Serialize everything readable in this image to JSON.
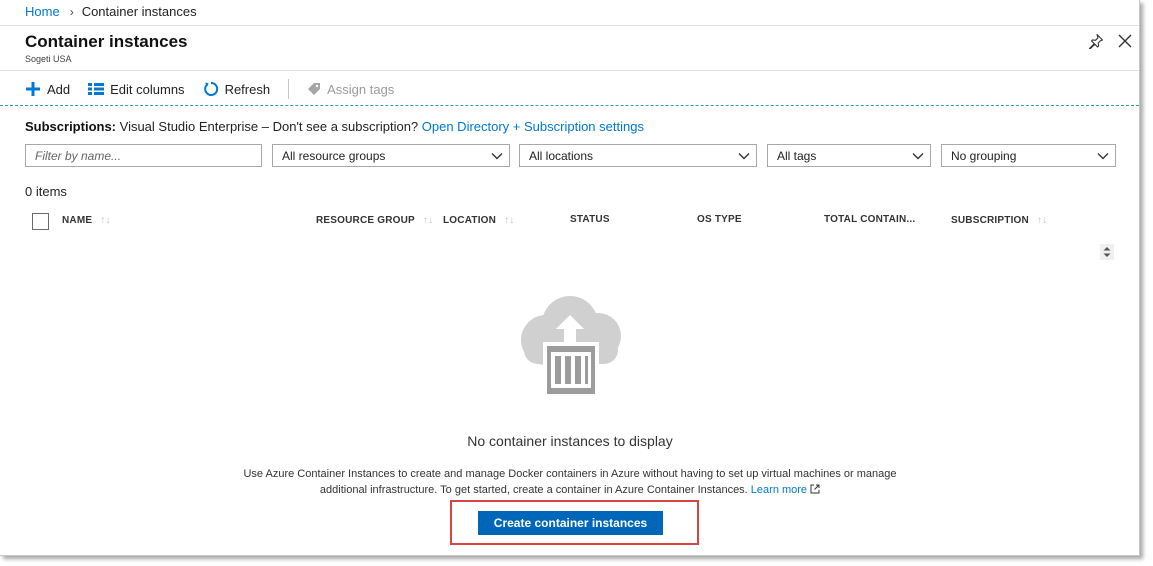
{
  "breadcrumb": {
    "home": "Home",
    "current": "Container instances"
  },
  "header": {
    "title": "Container instances",
    "subtitle": "Sogeti USA"
  },
  "toolbar": {
    "add": "Add",
    "edit_columns": "Edit columns",
    "refresh": "Refresh",
    "assign_tags": "Assign tags"
  },
  "subscriptions": {
    "label": "Subscriptions:",
    "text": " Visual Studio Enterprise – Don't see a subscription? ",
    "link": "Open Directory + Subscription settings"
  },
  "filters": {
    "name_placeholder": "Filter by name...",
    "resource_groups": "All resource groups",
    "locations": "All locations",
    "tags": "All tags",
    "grouping": "No grouping"
  },
  "count": "0 items",
  "columns": {
    "name": "NAME",
    "resource_group": "RESOURCE GROUP",
    "location": "LOCATION",
    "status": "STATUS",
    "os_type": "OS TYPE",
    "total_containers": "TOTAL CONTAIN...",
    "subscription": "SUBSCRIPTION",
    "sort_glyph": "↑↓"
  },
  "empty": {
    "title": "No container instances to display",
    "desc_line1": "Use Azure Container Instances to create and manage Docker containers in Azure without having to set up virtual machines or manage",
    "desc_line2": "additional infrastructure. To get started, create a container in Azure Container Instances. ",
    "learn_more": "Learn more",
    "button": "Create container instances"
  },
  "colors": {
    "accent": "#0078d4",
    "button": "#0067b8",
    "highlight": "#d64541",
    "icon_gray": "#a0a0a0"
  },
  "icons": [
    "chevron-right-icon",
    "pin-icon",
    "close-icon",
    "plus-icon",
    "columns-icon",
    "refresh-icon",
    "tag-icon",
    "chevron-down-icon",
    "sort-icon",
    "scroll-arrows-icon",
    "cloud-container-icon",
    "external-link-icon"
  ]
}
